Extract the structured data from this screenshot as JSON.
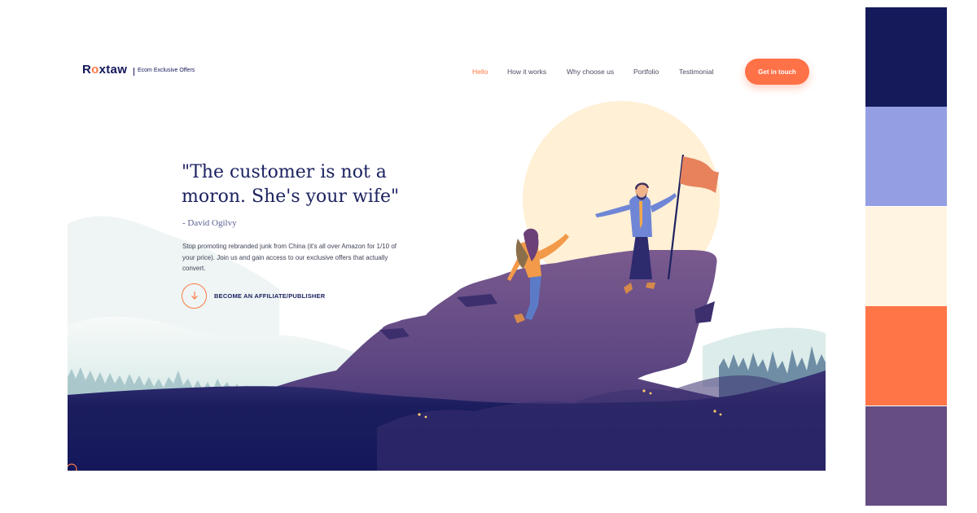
{
  "brand": {
    "logo_prefix": "R",
    "logo_o": "o",
    "logo_suffix": "xtaw",
    "tagline": "Ecom Exclusive Offers"
  },
  "nav": {
    "items": [
      {
        "label": "Hello",
        "active": true
      },
      {
        "label": "How it works",
        "active": false
      },
      {
        "label": "Why choose us",
        "active": false
      },
      {
        "label": "Portfolio",
        "active": false
      },
      {
        "label": "Testimonial",
        "active": false
      }
    ],
    "cta_label": "Get in touch"
  },
  "hero": {
    "quote": "\"The customer is not a moron. She's your wife\"",
    "author": "- David Ogilvy",
    "description": "Stop promoting rebranded junk from China (it's all over Amazon for 1/10 of your price). Join us and gain access to our exclusive offers that actually convert.",
    "cta_label": "BECOME AN AFFILIATE/PUBLISHER",
    "cta_icon": "arrow-down-icon"
  },
  "colors": {
    "navy": "#141a5a",
    "periwinkle": "#939fe2",
    "cream": "#fff4e2",
    "orange": "#ff7547",
    "purple": "#664d82"
  },
  "palette": [
    "#141a5a",
    "#939fe2",
    "#fff4e2",
    "#ff7547",
    "#664d82"
  ]
}
